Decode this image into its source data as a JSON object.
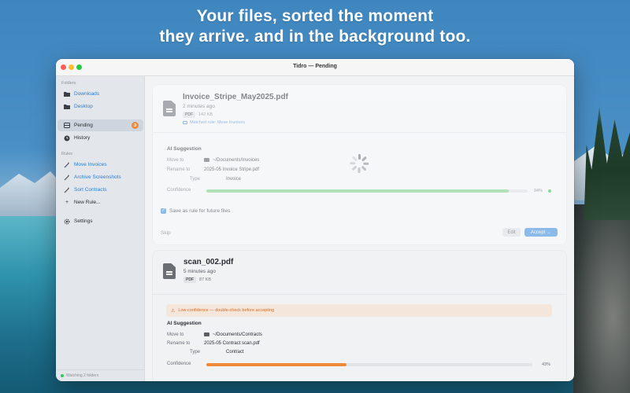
{
  "hero": {
    "line1": "Your files, sorted the moment",
    "line2": "they arrive. and in the background too."
  },
  "window": {
    "title": "Tidro — Pending"
  },
  "sidebar": {
    "folders_title": "Folders",
    "folders": [
      {
        "label": "Downloads",
        "icon": "folder-icon"
      },
      {
        "label": "Desktop",
        "icon": "folder-icon"
      }
    ],
    "nav": [
      {
        "label": "Pending",
        "icon": "tray-icon",
        "badge": "3",
        "active": true
      },
      {
        "label": "History",
        "icon": "clock-icon"
      }
    ],
    "rules_title": "Rules",
    "rules": [
      {
        "label": "Move Invoices",
        "icon": "wand-icon"
      },
      {
        "label": "Archive Screenshots",
        "icon": "wand-icon"
      },
      {
        "label": "Sort Contracts",
        "icon": "wand-icon"
      }
    ],
    "new_rule": "New Rule...",
    "settings": "Settings",
    "footer": "Watching 2 folders"
  },
  "cards": [
    {
      "filename": "Invoice_Stripe_May2025.pdf",
      "time": "2 minutes ago",
      "type_tag": "PDF",
      "size": "142 KB",
      "matched_rule": "Matched rule: Move Invoices",
      "ai_title": "AI Suggestion",
      "move_to_label": "Move to",
      "move_to_value": "~/Documents/Invoices",
      "rename_label": "Rename to",
      "rename_value": "2025-05 Invoice Stripe.pdf",
      "type_label": "Type",
      "type_value": "Invoice",
      "confidence_label": "Confidence",
      "confidence": 0.94,
      "confidence_text": "94%",
      "save_rule_label": "Save as rule for future files",
      "save_rule_checked": true,
      "skip_label": "Skip",
      "edit_label": "Edit",
      "accept_label": "Accept →",
      "loading": true
    },
    {
      "filename": "scan_002.pdf",
      "time": "5 minutes ago",
      "type_tag": "PDF",
      "size": "87 KB",
      "warning": "Low confidence — double-check before accepting",
      "ai_title": "AI Suggestion",
      "move_to_label": "Move to",
      "move_to_value": "~/Documents/Contracts",
      "rename_label": "Rename to",
      "rename_value": "2025-05 Contract scan.pdf",
      "type_label": "Type",
      "type_value": "Contract",
      "confidence_label": "Confidence",
      "confidence": 0.43,
      "confidence_text": "43%"
    }
  ],
  "colors": {
    "accent": "#3b8de0",
    "confidence_high": "#7bd389",
    "confidence_low": "#ee8a3a",
    "badge": "#f08a3c"
  }
}
